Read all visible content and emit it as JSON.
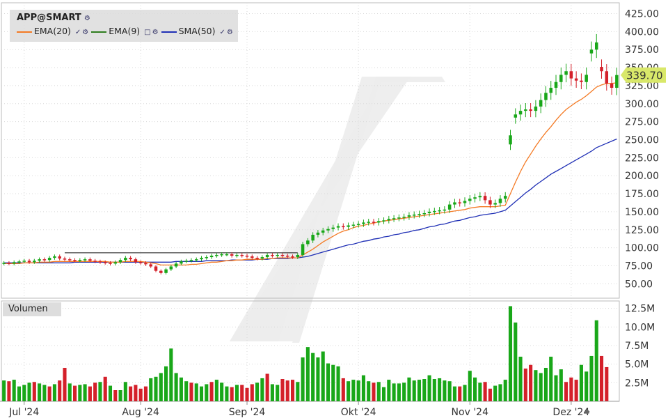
{
  "header": {
    "symbol": "APP@SMART",
    "indicators": [
      {
        "label": "EMA(20)",
        "color": "#f47a24"
      },
      {
        "label": "EMA(9)",
        "color": "#2e7d1e"
      },
      {
        "label": "SMA(50)",
        "color": "#1f2fb5"
      }
    ]
  },
  "volume_panel": {
    "label": "Volumen"
  },
  "last_price": "339.70",
  "colors": {
    "up": "#19a719",
    "down": "#d4202a",
    "grid": "#d8d8d8",
    "ema20": "#f47a24",
    "sma50": "#1f2fb5",
    "badge": "#d9e86a"
  },
  "chart_data": [
    {
      "type": "candlestick",
      "title": "",
      "y_ticks": [
        "50.00",
        "75.00",
        "100.00",
        "125.00",
        "150.00",
        "175.00",
        "200.00",
        "225.00",
        "250.00",
        "275.00",
        "300.00",
        "325.00",
        "350.00",
        "375.00",
        "400.00",
        "425.00"
      ],
      "ylim": [
        30,
        440
      ],
      "x_ticks": [
        "Jul '24",
        "Aug '24",
        "Sep '24",
        "Okt '24",
        "Nov '24",
        "Dez '24"
      ],
      "x_tick_index": [
        4,
        27,
        48,
        70,
        92,
        112
      ],
      "last_value": 339.7,
      "close": [
        79,
        78,
        80,
        81,
        82,
        80,
        82,
        84,
        83,
        86,
        88,
        85,
        84,
        83,
        82,
        83,
        84,
        82,
        81,
        80,
        79,
        78,
        80,
        83,
        86,
        84,
        80,
        79,
        77,
        74,
        68,
        65,
        70,
        74,
        78,
        81,
        82,
        83,
        84,
        86,
        87,
        89,
        90,
        91,
        91,
        89,
        90,
        89,
        88,
        86,
        85,
        87,
        90,
        89,
        90,
        89,
        88,
        87,
        90,
        105,
        110,
        118,
        121,
        124,
        126,
        128,
        130,
        129,
        131,
        132,
        133,
        135,
        136,
        135,
        137,
        138,
        140,
        141,
        142,
        143,
        145,
        146,
        147,
        148,
        150,
        151,
        152,
        153,
        160,
        163,
        162,
        165,
        168,
        170,
        172,
        166,
        160,
        162,
        168,
        172,
        256,
        285,
        290,
        292,
        290,
        296,
        305,
        315,
        322,
        330,
        340,
        345,
        335,
        332,
        330,
        340,
        375,
        385,
        345,
        328,
        322,
        339.7
      ],
      "ema20": [
        78,
        78,
        78,
        78,
        79,
        79,
        79,
        80,
        80,
        80,
        81,
        81,
        81,
        81,
        81,
        81,
        81,
        81,
        81,
        81,
        81,
        80,
        80,
        80,
        81,
        81,
        81,
        81,
        80,
        79,
        78,
        76,
        76,
        76,
        76,
        76,
        76,
        77,
        77,
        78,
        79,
        80,
        80,
        81,
        82,
        82,
        83,
        83,
        84,
        84,
        84,
        84,
        85,
        85,
        86,
        86,
        86,
        86,
        86,
        90,
        94,
        98,
        103,
        108,
        112,
        116,
        120,
        123,
        125,
        128,
        130,
        131,
        133,
        134,
        136,
        137,
        138,
        139,
        140,
        141,
        142,
        143,
        144,
        145,
        146,
        147,
        148,
        149,
        150,
        151,
        152,
        153,
        155,
        156,
        157,
        157,
        157,
        157,
        158,
        159,
        175,
        191,
        206,
        219,
        230,
        241,
        251,
        260,
        268,
        277,
        285,
        292,
        297,
        302,
        306,
        311,
        317,
        323,
        326,
        328,
        328,
        329
      ],
      "sma50": [
        79,
        79,
        79,
        79,
        79,
        79,
        79,
        79,
        79,
        79,
        79,
        79,
        79,
        79,
        80,
        80,
        80,
        80,
        80,
        80,
        80,
        80,
        80,
        80,
        80,
        80,
        80,
        80,
        80,
        80,
        80,
        80,
        80,
        80,
        81,
        81,
        81,
        81,
        81,
        81,
        82,
        82,
        82,
        82,
        82,
        83,
        83,
        83,
        83,
        83,
        84,
        84,
        84,
        85,
        85,
        85,
        85,
        86,
        86,
        87,
        88,
        90,
        92,
        94,
        96,
        98,
        100,
        102,
        104,
        105,
        107,
        109,
        110,
        112,
        113,
        115,
        116,
        118,
        119,
        121,
        122,
        124,
        125,
        127,
        129,
        130,
        132,
        133,
        135,
        137,
        138,
        140,
        142,
        143,
        145,
        146,
        147,
        148,
        150,
        152,
        158,
        164,
        170,
        176,
        181,
        187,
        192,
        197,
        202,
        206,
        210,
        214,
        218,
        222,
        226,
        230,
        234,
        239,
        242,
        245,
        248,
        251
      ],
      "volume_ticks": [
        "2.5M",
        "5.0M",
        "7.5M",
        "10.0M",
        "12.5M"
      ],
      "volume_ylim": [
        0,
        13500000
      ],
      "volume": [
        2.8,
        2.7,
        2.9,
        2.0,
        2.2,
        2.5,
        2.6,
        2.4,
        2.2,
        2.0,
        2.3,
        2.8,
        4.5,
        2.4,
        2.1,
        2.2,
        2.3,
        2.0,
        2.5,
        2.6,
        3.3,
        2.1,
        1.5,
        1.5,
        2.6,
        2.0,
        2.2,
        1.7,
        2.0,
        3.1,
        3.3,
        3.8,
        4.7,
        7.1,
        3.8,
        3.2,
        2.7,
        2.5,
        2.4,
        2.0,
        2.3,
        2.6,
        2.9,
        2.5,
        2.0,
        1.9,
        2.2,
        2.2,
        1.8,
        2.3,
        2.5,
        3.1,
        3.7,
        2.3,
        2.2,
        3.0,
        2.8,
        2.9,
        2.6,
        5.9,
        7.3,
        6.5,
        5.9,
        6.7,
        5.1,
        4.9,
        4.7,
        3.1,
        2.7,
        2.9,
        2.8,
        3.5,
        2.7,
        2.5,
        2.6,
        1.9,
        2.9,
        2.4,
        2.4,
        2.5,
        3.2,
        2.8,
        2.9,
        3.0,
        3.5,
        3.0,
        3.1,
        2.8,
        2.7,
        2.0,
        2.0,
        2.2,
        4.1,
        3.2,
        2.5,
        2.6,
        1.7,
        2.1,
        2.3,
        2.9,
        12.8,
        10.6,
        6.0,
        4.4,
        4.9,
        4.2,
        3.8,
        4.5,
        6.0,
        3.5,
        4.3,
        2.6,
        3.2,
        2.9,
        4.9,
        4.0,
        6.1,
        10.9,
        6.1,
        4.6
      ],
      "volume_up": [
        1,
        0,
        1,
        1,
        1,
        1,
        0,
        1,
        1,
        0,
        1,
        0,
        0,
        1,
        0,
        1,
        1,
        0,
        0,
        1,
        0,
        1,
        0,
        1,
        1,
        0,
        0,
        0,
        0,
        1,
        1,
        1,
        1,
        1,
        1,
        1,
        1,
        0,
        1,
        1,
        1,
        0,
        1,
        1,
        1,
        0,
        1,
        0,
        0,
        0,
        1,
        1,
        0,
        1,
        1,
        0,
        0,
        0,
        1,
        1,
        1,
        1,
        1,
        1,
        1,
        1,
        1,
        0,
        1,
        1,
        1,
        1,
        1,
        0,
        1,
        1,
        1,
        1,
        1,
        1,
        1,
        1,
        1,
        1,
        1,
        1,
        1,
        1,
        1,
        1,
        0,
        1,
        1,
        1,
        1,
        0,
        0,
        1,
        1,
        1,
        1,
        1,
        1,
        0,
        0,
        1,
        1,
        1,
        1,
        1,
        1,
        0,
        0,
        0,
        1,
        1,
        1,
        1,
        0,
        0,
        0,
        1
      ]
    }
  ]
}
